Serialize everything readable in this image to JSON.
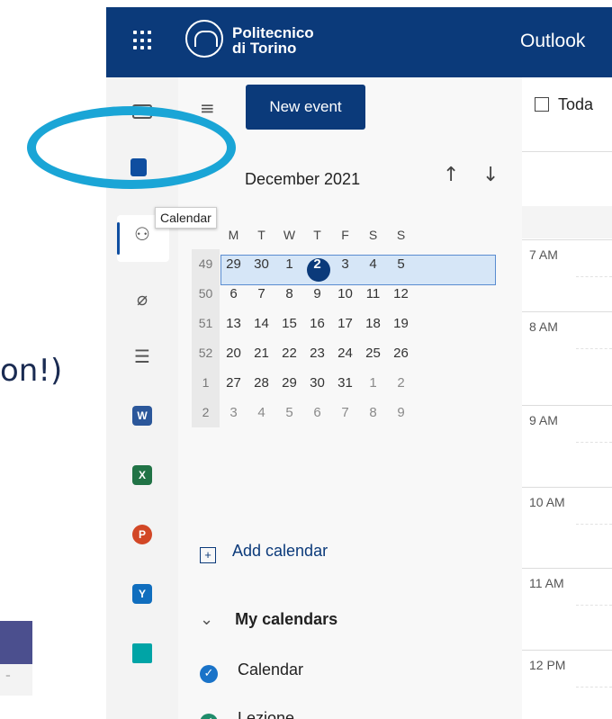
{
  "slide": {
    "fragment_text": "on!)",
    "teams_glyph": "⁼"
  },
  "header": {
    "brand_line1": "Politecnico",
    "brand_line2": "di Torino",
    "app_name": "Outlook"
  },
  "rail": {
    "tooltip": "Calendar"
  },
  "toolbar": {
    "new_event_label": "New event",
    "today_label": "Toda"
  },
  "mini_calendar": {
    "month_label": "December 2021",
    "weekdays": [
      "M",
      "T",
      "W",
      "T",
      "F",
      "S",
      "S"
    ],
    "weeks": [
      {
        "num": "49",
        "days": [
          "29",
          "30",
          "1",
          "2",
          "3",
          "4",
          "5"
        ]
      },
      {
        "num": "50",
        "days": [
          "6",
          "7",
          "8",
          "9",
          "10",
          "11",
          "12"
        ]
      },
      {
        "num": "51",
        "days": [
          "13",
          "14",
          "15",
          "16",
          "17",
          "18",
          "19"
        ]
      },
      {
        "num": "52",
        "days": [
          "20",
          "21",
          "22",
          "23",
          "24",
          "25",
          "26"
        ]
      },
      {
        "num": "1",
        "days": [
          "27",
          "28",
          "29",
          "30",
          "31",
          "1",
          "2"
        ]
      },
      {
        "num": "2",
        "days": [
          "3",
          "4",
          "5",
          "6",
          "7",
          "8",
          "9"
        ]
      }
    ]
  },
  "sidebar": {
    "add_calendar_label": "Add calendar",
    "my_calendars_label": "My calendars",
    "calendars": [
      {
        "name": "Calendar",
        "color": "#1a73c8"
      },
      {
        "name": "Lezione",
        "color": "#1f8c6b"
      }
    ]
  },
  "day_view": {
    "hours": [
      "7 AM",
      "8 AM",
      "9 AM",
      "10 AM",
      "11 AM",
      "12 PM"
    ]
  },
  "colors": {
    "brand": "#0b3a7a",
    "highlight_ring": "#1aa5d6",
    "selected_week": "#d6e6f7"
  },
  "icons": {
    "word": "W",
    "excel": "X",
    "powerpoint": "P",
    "yammer": "Y"
  }
}
